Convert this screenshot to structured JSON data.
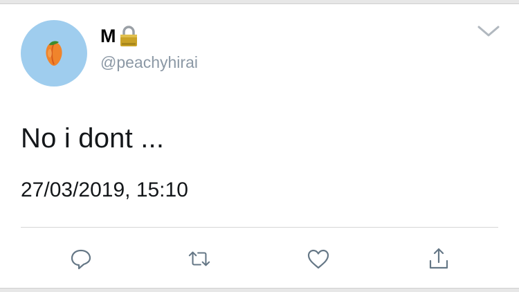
{
  "tweet": {
    "display_name": "M",
    "handle": "@peachyhirai",
    "text": "No i dont ...",
    "timestamp": "27/03/2019, 15:10"
  },
  "icons": {
    "avatar": "peach-emoji-icon",
    "verified_lock": "lock-icon",
    "more": "chevron-down-icon",
    "reply": "reply-icon",
    "retweet": "retweet-icon",
    "like": "heart-icon",
    "share": "share-icon"
  },
  "colors": {
    "avatar_bg": "#9fcdee",
    "text": "#14171a",
    "handle": "#8b98a5",
    "icon": "#657786"
  }
}
